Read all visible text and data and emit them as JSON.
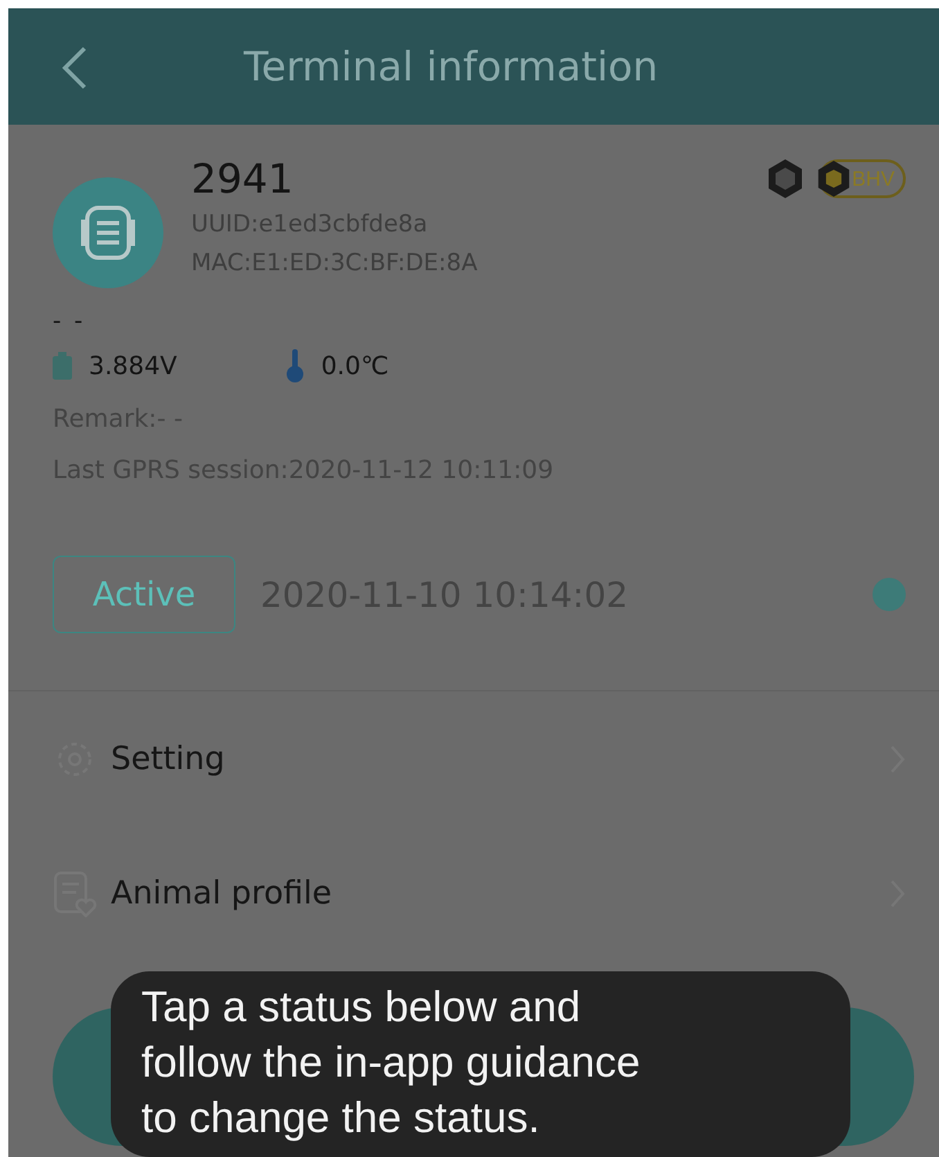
{
  "header": {
    "title": "Terminal information"
  },
  "device": {
    "name": "2941",
    "uuid": "UUID:e1ed3cbfde8a",
    "mac": "MAC:E1:ED:3C:BF:DE:8A",
    "badge": "BHV"
  },
  "note": "- -",
  "readings": {
    "voltage": "3.884V",
    "temperature": "0.0℃"
  },
  "remark": "Remark:- -",
  "last_session": "Last GPRS session:2020-11-12 10:11:09",
  "status": {
    "label": "Active",
    "time": "2020-11-10 10:14:02"
  },
  "menu": [
    {
      "kind": "setting",
      "label": "Setting"
    },
    {
      "kind": "profile",
      "label": "Animal profile"
    }
  ],
  "toast": "Tap a status below and follow the in-app guidance to change the status."
}
